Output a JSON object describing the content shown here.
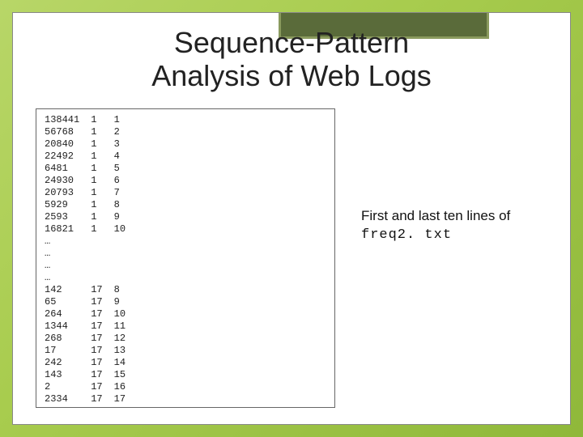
{
  "title_line1": "Sequence-Pattern",
  "title_line2": "Analysis of Web Logs",
  "caption_text": " First and last ten lines of ",
  "caption_filename": "freq2. txt",
  "data_rows_top": [
    {
      "c1": "138441",
      "c2": "1",
      "c3": "1"
    },
    {
      "c1": "56768",
      "c2": "1",
      "c3": "2"
    },
    {
      "c1": "20840",
      "c2": "1",
      "c3": "3"
    },
    {
      "c1": "22492",
      "c2": "1",
      "c3": "4"
    },
    {
      "c1": "6481",
      "c2": "1",
      "c3": "5"
    },
    {
      "c1": "24930",
      "c2": "1",
      "c3": "6"
    },
    {
      "c1": "20793",
      "c2": "1",
      "c3": "7"
    },
    {
      "c1": "5929",
      "c2": "1",
      "c3": "8"
    },
    {
      "c1": "2593",
      "c2": "1",
      "c3": "9"
    },
    {
      "c1": "16821",
      "c2": "1",
      "c3": "10"
    }
  ],
  "ellipsis_rows": [
    "…",
    "…",
    "…",
    "…"
  ],
  "data_rows_bottom": [
    {
      "c1": "142",
      "c2": "17",
      "c3": "8"
    },
    {
      "c1": "65",
      "c2": "17",
      "c3": "9"
    },
    {
      "c1": "264",
      "c2": "17",
      "c3": "10"
    },
    {
      "c1": "1344",
      "c2": "17",
      "c3": "11"
    },
    {
      "c1": "268",
      "c2": "17",
      "c3": "12"
    },
    {
      "c1": "17",
      "c2": "17",
      "c3": "13"
    },
    {
      "c1": "242",
      "c2": "17",
      "c3": "14"
    },
    {
      "c1": "143",
      "c2": "17",
      "c3": "15"
    },
    {
      "c1": "2",
      "c2": "17",
      "c3": "16"
    },
    {
      "c1": "2334",
      "c2": "17",
      "c3": "17"
    }
  ]
}
